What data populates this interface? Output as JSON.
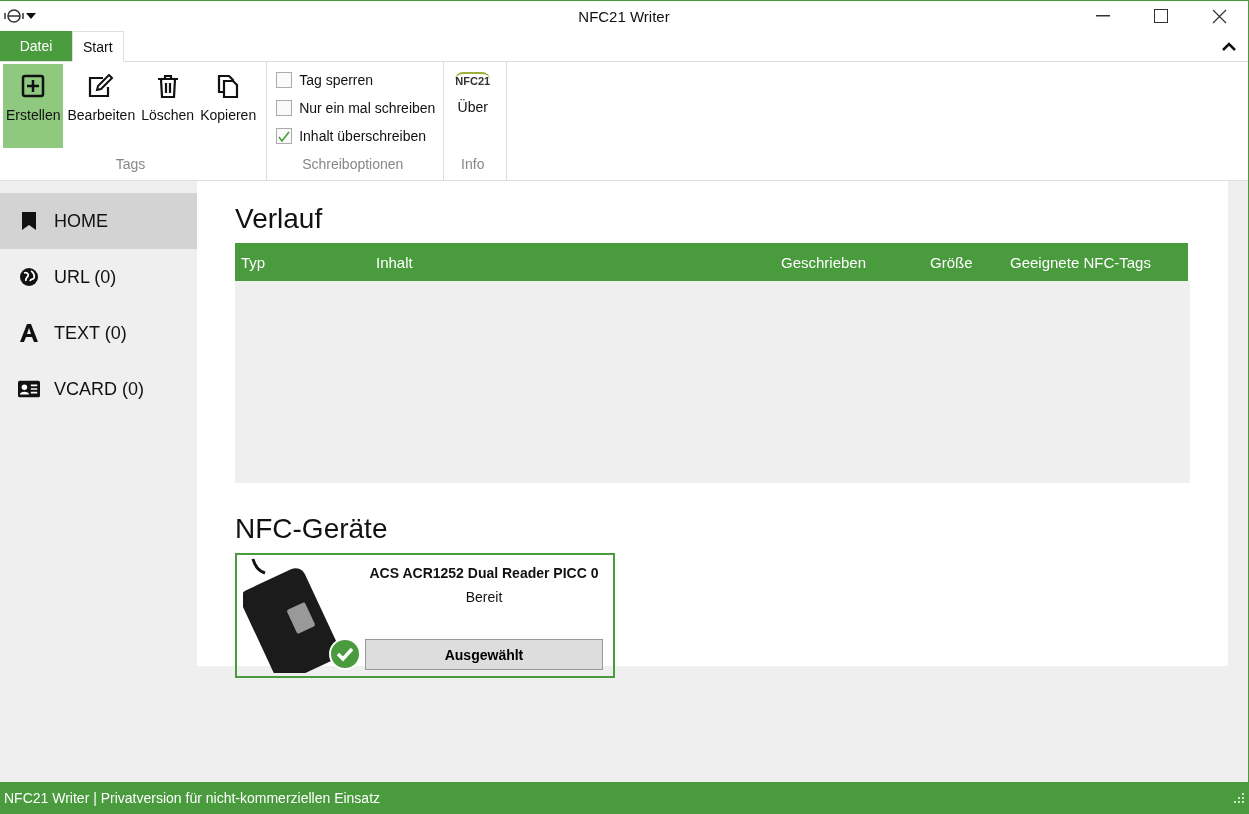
{
  "window": {
    "title": "NFC21 Writer"
  },
  "ribbon_tabs": [
    {
      "label": "Datei",
      "kind": "file",
      "selected": false
    },
    {
      "label": "Start",
      "kind": "tab",
      "selected": true
    }
  ],
  "ribbon_groups": [
    {
      "label": "Tags",
      "kind": "buttons",
      "buttons": [
        {
          "label": "Erstellen",
          "selected": true
        },
        {
          "label": "Bearbeiten",
          "selected": false
        },
        {
          "label": "Löschen",
          "selected": false
        },
        {
          "label": "Kopieren",
          "selected": false
        }
      ]
    },
    {
      "label": "Schreiboptionen",
      "kind": "checks",
      "options": [
        {
          "label": "Tag sperren",
          "checked": false
        },
        {
          "label": "Nur ein mal schreiben",
          "checked": false
        },
        {
          "label": "Inhalt überschreiben",
          "checked": true
        }
      ]
    },
    {
      "label": "Info",
      "kind": "logo",
      "logo_text": "NFC21",
      "button": "Über"
    }
  ],
  "sidebar": {
    "items": [
      {
        "label": "HOME",
        "selected": true
      },
      {
        "label": "URL (0)",
        "selected": false
      },
      {
        "label": "TEXT (0)",
        "selected": false
      },
      {
        "label": "VCARD (0)",
        "selected": false
      }
    ]
  },
  "history": {
    "title": "Verlauf",
    "columns": [
      "Typ",
      "Inhalt",
      "Geschrieben",
      "Größe",
      "Geeignete NFC-Tags"
    ]
  },
  "devices": {
    "title": "NFC-Geräte",
    "items": [
      {
        "name": "ACS ACR1252 Dual Reader PICC 0",
        "status": "Bereit",
        "button": "Ausgewählt",
        "selected": true
      }
    ]
  },
  "status_bar": "NFC21 Writer | Privatversion für nicht-kommerziellen Einsatz"
}
